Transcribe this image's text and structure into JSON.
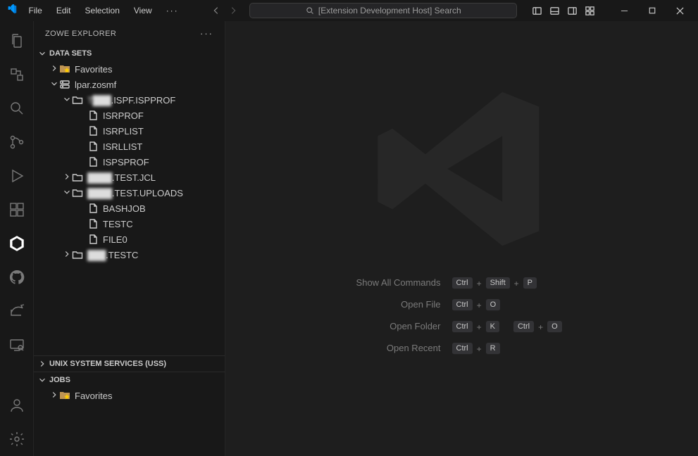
{
  "titlebar": {
    "menus": [
      "File",
      "Edit",
      "Selection",
      "View"
    ],
    "search_text": "[Extension Development Host] Search"
  },
  "sidebar": {
    "title": "ZOWE EXPLORER",
    "sections": {
      "datasets": {
        "label": "DATA SETS",
        "favorites": "Favorites",
        "profile": "lpar.zosmf",
        "ds1": {
          "name": ".ISPF.ISPPROF",
          "members": [
            "ISRPROF",
            "ISRPLIST",
            "ISRLLIST",
            "ISPSPROF"
          ]
        },
        "ds2": {
          "name": ".TEST.JCL"
        },
        "ds3": {
          "name": ".TEST.UPLOADS",
          "members": [
            "BASHJOB",
            "TESTC",
            "FILE0"
          ]
        },
        "ds4": {
          "name": ".TESTC"
        }
      },
      "uss": {
        "label": "UNIX SYSTEM SERVICES (USS)"
      },
      "jobs": {
        "label": "JOBS",
        "favorites": "Favorites"
      }
    }
  },
  "welcome": {
    "rows": [
      {
        "label": "Show All Commands",
        "keys": [
          "Ctrl",
          "+",
          "Shift",
          "+",
          "P"
        ]
      },
      {
        "label": "Open File",
        "keys": [
          "Ctrl",
          "+",
          "O"
        ]
      },
      {
        "label": "Open Folder",
        "keys": [
          "Ctrl",
          "+",
          "K",
          " ",
          "Ctrl",
          "+",
          "O"
        ]
      },
      {
        "label": "Open Recent",
        "keys": [
          "Ctrl",
          "+",
          "R"
        ]
      }
    ]
  }
}
